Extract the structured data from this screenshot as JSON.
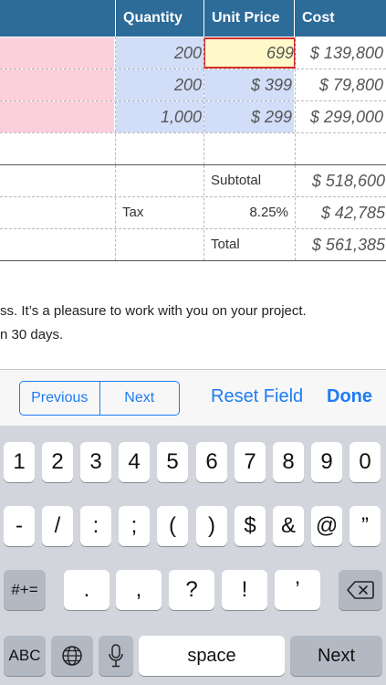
{
  "sheet": {
    "headers": [
      "",
      "Quantity",
      "Unit Price",
      "Cost"
    ],
    "rows": [
      {
        "quantity": "200",
        "unit_price": "699",
        "cost": "$ 139,800"
      },
      {
        "quantity": "200",
        "unit_price": "$ 399",
        "cost": "$ 79,800"
      },
      {
        "quantity": "1,000",
        "unit_price": "$ 299",
        "cost": "$ 299,000"
      }
    ],
    "subtotal_label": "Subtotal",
    "subtotal_value": "$ 518,600",
    "tax_label": "Tax",
    "tax_rate": "8.25%",
    "tax_value": "$ 42,785",
    "total_label": "Total",
    "total_value": "$ 561,385"
  },
  "notes": {
    "line1": "ss. It’s a pleasure to work with you on your project.",
    "line2": "n 30 days."
  },
  "accessory": {
    "previous": "Previous",
    "next": "Next",
    "reset": "Reset Field",
    "done": "Done"
  },
  "keyboard": {
    "row1": [
      "1",
      "2",
      "3",
      "4",
      "5",
      "6",
      "7",
      "8",
      "9",
      "0"
    ],
    "row2": [
      "-",
      "/",
      ":",
      ";",
      "(",
      ")",
      "$",
      "&",
      "@",
      "”"
    ],
    "row3": {
      "shift": "#+=",
      "keys": [
        ".",
        ",",
        "?",
        "!",
        "’"
      ],
      "delete_icon": "backspace-icon"
    },
    "row4": {
      "abc": "ABC",
      "globe_icon": "globe-icon",
      "mic_icon": "microphone-icon",
      "space": "space",
      "next": "Next"
    }
  },
  "colors": {
    "header_bg": "#2d6b99",
    "accent": "#1d7cf2",
    "pink_cell": "#fbd0dc",
    "blue_cell": "#d2def8",
    "selected_cell": "#fff8c9",
    "selection_border": "#d62b2b"
  }
}
